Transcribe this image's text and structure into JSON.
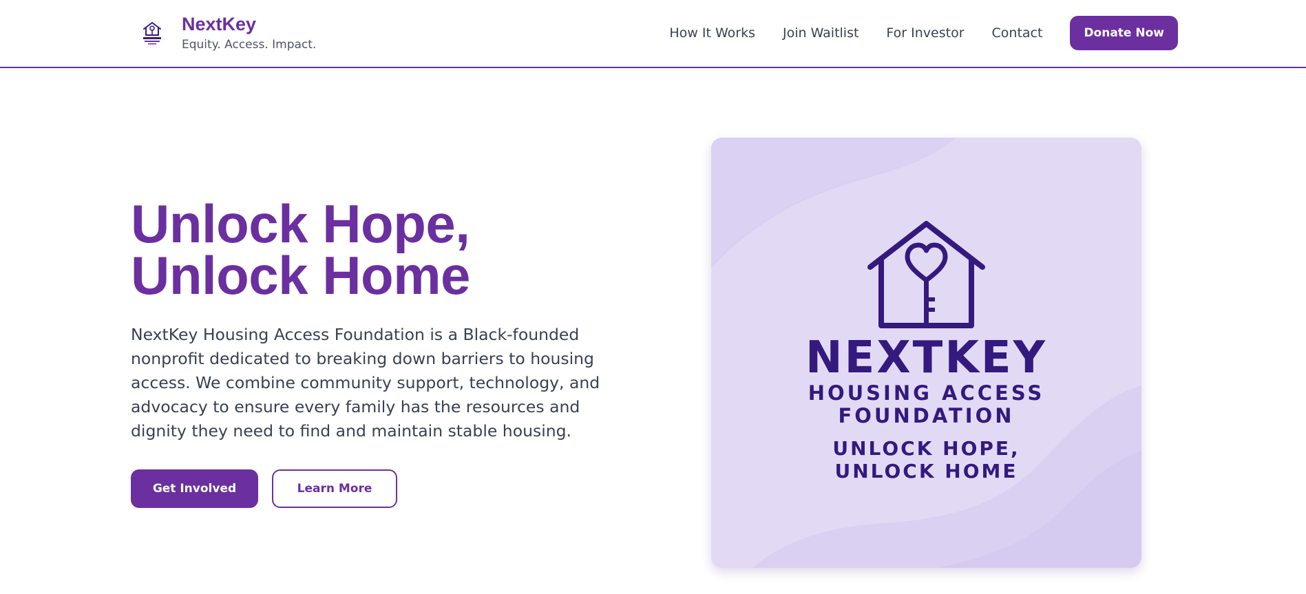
{
  "header": {
    "brand_name": "NextKey",
    "tagline": "Equity. Access. Impact.",
    "nav": [
      {
        "label": "How It Works"
      },
      {
        "label": "Join Waitlist"
      },
      {
        "label": "For Investor"
      },
      {
        "label": "Contact"
      }
    ],
    "donate_label": "Donate Now"
  },
  "hero": {
    "title_line1": "Unlock Hope,",
    "title_line2": "Unlock Home",
    "description": "NextKey Housing Access Foundation is a Black-founded nonprofit dedicated to breaking down barriers to housing access. We combine community support, technology, and advocacy to ensure every family has the resources and dignity they need to find and maintain stable housing.",
    "primary_cta": "Get Involved",
    "secondary_cta": "Learn More"
  },
  "hero_card": {
    "name": "NEXTKEY",
    "subtitle_line1": "HOUSING ACCESS",
    "subtitle_line2": "FOUNDATION",
    "motto_line1": "UNLOCK HOPE,",
    "motto_line2": "UNLOCK HOME"
  },
  "icons": {
    "logo": "house-key-logo-icon",
    "card_emblem": "house-heart-key-icon"
  },
  "colors": {
    "brand_purple": "#6b2fa0",
    "deep_indigo": "#34197f",
    "card_bg": "#e2daf4",
    "header_border": "#6b2fa0",
    "body_text": "#374151"
  }
}
